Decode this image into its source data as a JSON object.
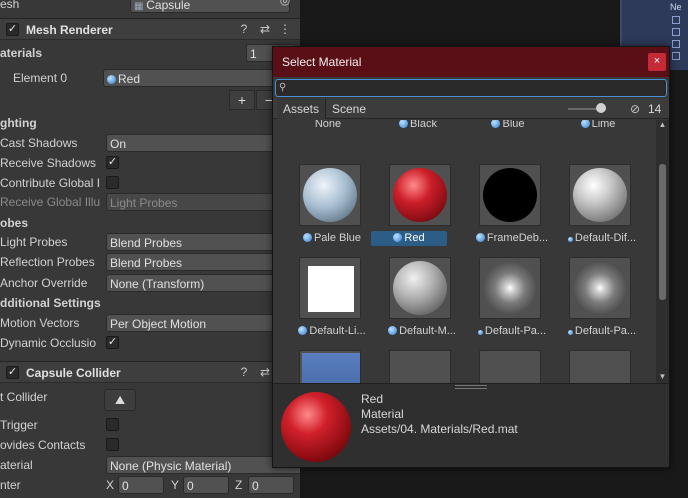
{
  "inspector": {
    "top_label": "esh",
    "top_value": "Capsule",
    "mesh_renderer": {
      "title": "Mesh Renderer"
    },
    "materials": {
      "label": "aterials",
      "count": "1",
      "element0_label": "Element 0",
      "element0_value": "Red"
    },
    "add_symbol": "+",
    "remove_symbol": "−",
    "lighting": {
      "section": "ghting",
      "cast_shadows_label": "Cast Shadows",
      "cast_shadows_value": "On",
      "receive_shadows_label": "Receive Shadows",
      "receive_shadows_checked": true,
      "contribute_gi_label": "Contribute Global I",
      "contribute_gi_checked": false,
      "receive_gi_label": "Receive Global Illu",
      "receive_gi_value": "Light Probes"
    },
    "probes": {
      "section": "obes",
      "light_probes_label": "Light Probes",
      "light_probes_value": "Blend Probes",
      "reflection_probes_label": "Reflection Probes",
      "reflection_probes_value": "Blend Probes",
      "anchor_override_label": "Anchor Override",
      "anchor_override_value": "None (Transform)"
    },
    "additional": {
      "section": "dditional Settings",
      "motion_vectors_label": "Motion Vectors",
      "motion_vectors_value": "Per Object Motion",
      "dynamic_occlusion_label": "Dynamic Occlusio",
      "dynamic_occlusion_checked": true
    },
    "capsule_collider": {
      "title": "Capsule Collider",
      "edit_collider_label": "t Collider",
      "trigger_label": "Trigger",
      "provides_contacts_label": "ovides Contacts",
      "material_label": "aterial",
      "material_value": "None (Physic Material)",
      "center_label": "nter",
      "x_label": "X",
      "x_value": "0",
      "y_label": "Y",
      "y_value": "0",
      "z_label": "Z",
      "z_value": "0"
    }
  },
  "hierarchy": {
    "row0": "Ne"
  },
  "picker": {
    "title": "Select Material",
    "close_symbol": "×",
    "search_value": "",
    "tabs": [
      "Assets",
      "Scene"
    ],
    "visible_count": "14",
    "grid_row0": [
      "None",
      "Black",
      "Blue",
      "Lime"
    ],
    "grid_row1": [
      "Pale Blue",
      "Red",
      "FrameDeb...",
      "Default-Dif..."
    ],
    "grid_row2": [
      "Default-Li...",
      "Default-M...",
      "Default-Pa...",
      "Default-Pa..."
    ],
    "selected": "Red",
    "preview": {
      "name": "Red",
      "type": "Material",
      "path": "Assets/04. Materials/Red.mat"
    },
    "colors": {
      "title_bar": "#5a0f16",
      "selection": "#2c5d87",
      "search_border": "#4a90d9"
    }
  }
}
